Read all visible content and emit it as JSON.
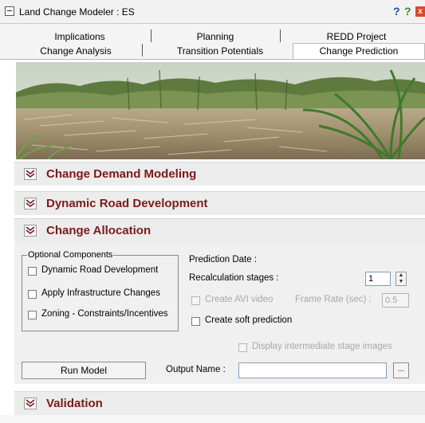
{
  "window": {
    "title": "Land Change Modeler : ES",
    "help_glyph_1": "?",
    "help_glyph_2": "?",
    "close_glyph": "x"
  },
  "tabs": {
    "row1": [
      "Implications",
      "Planning",
      "REDD Project"
    ],
    "row2": [
      "Change Analysis",
      "Transition Potentials",
      "Change Prediction"
    ],
    "active": "Change Prediction"
  },
  "sections": {
    "change_demand": "Change Demand Modeling",
    "dynamic_road": "Dynamic Road Development",
    "change_allocation": "Change Allocation",
    "validation": "Validation"
  },
  "allocation": {
    "optional_title": "Optional Components",
    "optional": [
      {
        "label": "Dynamic Road Development",
        "checked": false
      },
      {
        "label": "Apply Infrastructure Changes",
        "checked": false
      },
      {
        "label": "Zoning - Constraints/Incentives",
        "checked": false
      }
    ],
    "prediction_date_label": "Prediction Date :",
    "recalc_label": "Recalculation stages :",
    "recalc_value": "1",
    "create_avi_label": "Create AVI video",
    "frame_rate_label": "Frame Rate  (sec) :",
    "frame_rate_value": "0.5",
    "soft_prediction_label": "Create soft prediction",
    "display_intermediate_label": "Display intermediate stage images",
    "run_model_label": "Run Model",
    "output_name_label": "Output Name :",
    "output_name_value": "",
    "browse_label": "..."
  },
  "colors": {
    "section_title": "#7b1a1a",
    "section_bg": "#ececec",
    "panel_bg": "#f0f0f0"
  }
}
